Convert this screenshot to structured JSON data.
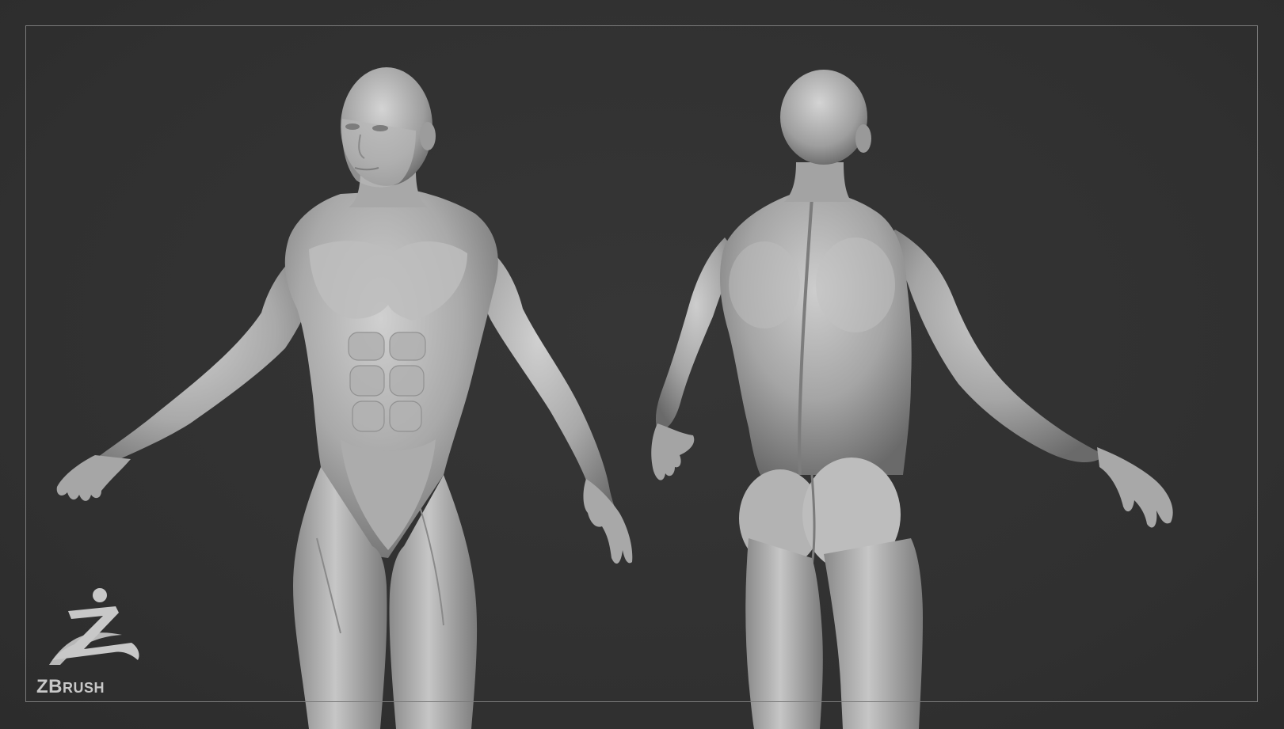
{
  "scene": {
    "background_color": "#323232",
    "frame_color": "#7a7a7a",
    "skin_color": "#b9b9b9",
    "views": [
      "front-three-quarter",
      "back-three-quarter"
    ]
  },
  "logo": {
    "brand_prefix": "ZB",
    "brand_suffix": "RUSH",
    "icon": "zbrush-runner-icon",
    "color": "#c8c8c8"
  }
}
